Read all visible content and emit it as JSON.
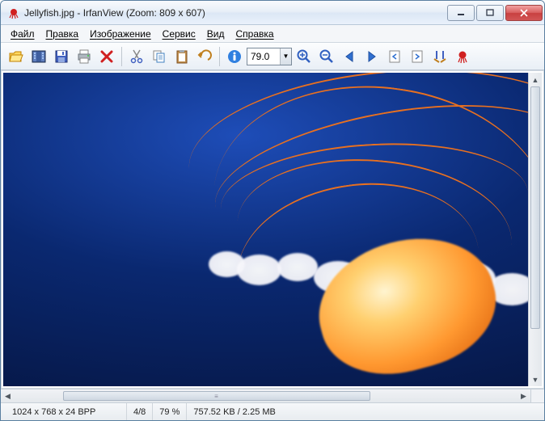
{
  "title": "Jellyfish.jpg - IrfanView (Zoom: 809 x 607)",
  "menu": {
    "file": "Файл",
    "edit": "Правка",
    "image": "Изображение",
    "service": "Сервис",
    "view": "Вид",
    "help": "Справка"
  },
  "toolbar": {
    "zoom_value": "79.0"
  },
  "status": {
    "dimensions": "1024 x 768 x 24 BPP",
    "index": "4/8",
    "zoom": "79 %",
    "filesize": "757.52 KB / 2.25 MB"
  }
}
